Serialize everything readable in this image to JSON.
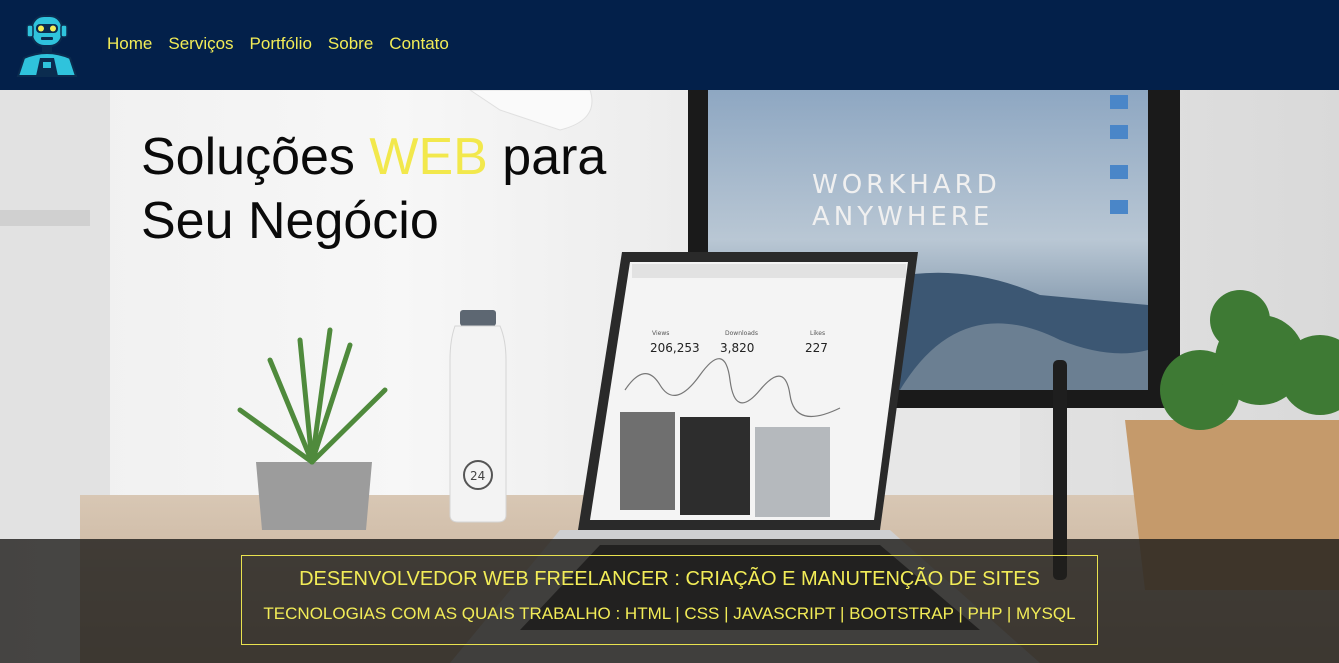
{
  "nav": {
    "items": [
      {
        "label": "Home"
      },
      {
        "label": "Serviços"
      },
      {
        "label": "Portfólio"
      },
      {
        "label": "Sobre"
      },
      {
        "label": "Contato"
      }
    ]
  },
  "hero": {
    "headline_part1": "Soluções ",
    "headline_accent": "WEB",
    "headline_part2": " para",
    "headline_line2": "Seu Negócio",
    "monitor_text_line1": "WORKHARD",
    "monitor_text_line2": "ANYWHERE",
    "laptop_stat1_label": "Views",
    "laptop_stat1_value": "206,253",
    "laptop_stat2_label": "Downloads",
    "laptop_stat2_value": "3,820",
    "laptop_stat3_label": "Likes",
    "laptop_stat3_value": "227",
    "bottle_label": "24"
  },
  "banner": {
    "title": "DESENVOLVEDOR WEB FREELANCER : CRIAÇÃO E MANUTENÇÃO DE SITES",
    "subtitle": "TECNOLOGIAS COM AS QUAIS TRABALHO : HTML | CSS | JAVASCRIPT | BOOTSTRAP | PHP | MYSQL"
  },
  "colors": {
    "navbar_bg": "#03204a",
    "accent_yellow": "#f2ec57",
    "band_bg": "#201e1c"
  },
  "icons": {
    "logo": "robot-logo-icon"
  }
}
